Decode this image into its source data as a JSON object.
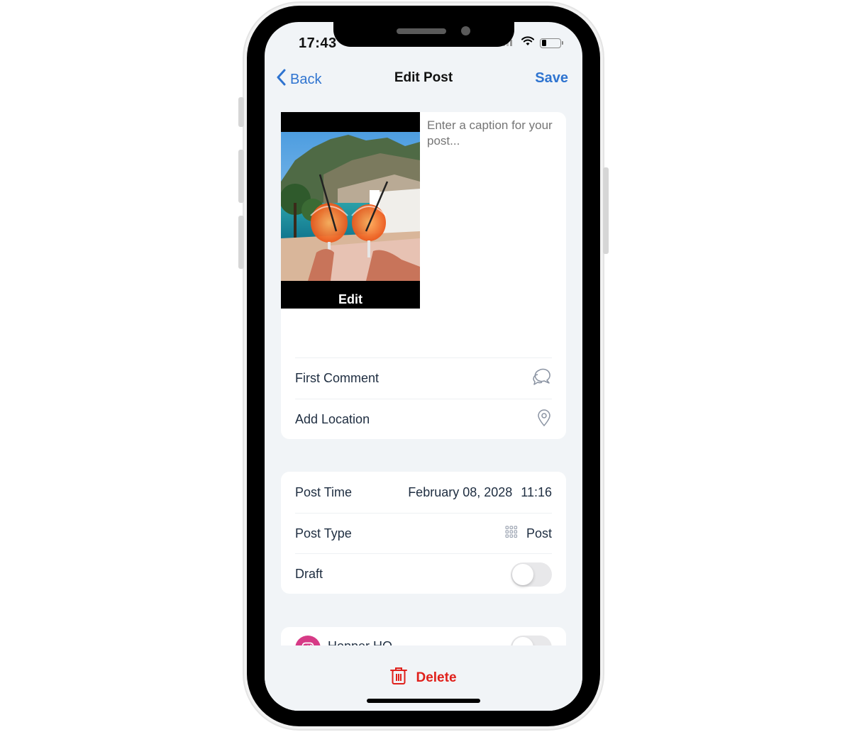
{
  "status_bar": {
    "time": "17:43",
    "battery_level": 0.25
  },
  "nav": {
    "back_label": "Back",
    "title": "Edit Post",
    "save_label": "Save"
  },
  "media": {
    "edit_label": "Edit",
    "image_description": "Two Aperol spritz glasses toasting over a coastal cliffside village and blue bay"
  },
  "caption": {
    "value": "",
    "placeholder": "Enter a caption for your post..."
  },
  "details": {
    "first_comment_label": "First Comment",
    "first_comment_icon": "chat-bubbles-icon",
    "add_location_label": "Add Location",
    "add_location_icon": "map-pin-icon"
  },
  "settings": {
    "post_time_label": "Post Time",
    "post_date": "February 08, 2028",
    "post_time": "11:16",
    "post_type_label": "Post Type",
    "post_type_icon": "grid-icon",
    "post_type_value": "Post",
    "draft_label": "Draft",
    "draft_on": false
  },
  "accounts": [
    {
      "name": "Hopper HQ",
      "network": "instagram",
      "enabled": false,
      "color": "#d63a86"
    }
  ],
  "footer": {
    "delete_label": "Delete",
    "delete_color": "#e0201b"
  },
  "colors": {
    "accent": "#2f74d0",
    "background": "#f1f4f7",
    "text": "#1e2d40",
    "placeholder": "#9aa3b2"
  }
}
